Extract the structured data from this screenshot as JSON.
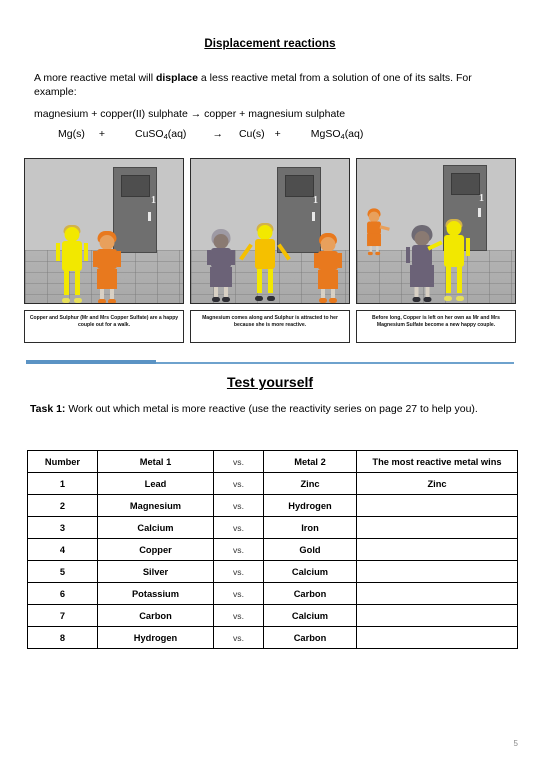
{
  "document": {
    "title": "Displacement reactions",
    "page_number": "5"
  },
  "intro": {
    "before_bold": "A more reactive metal will ",
    "bold": "displace",
    "after_bold": " a less reactive metal from a solution of one of its salts. For example:",
    "word_equation": "magnesium + copper(II) sulphate → copper + magnesium sulphate",
    "symbol_equation": {
      "reactant1": "Mg(s)",
      "plus1": "+",
      "reactant2_main": "CuSO",
      "reactant2_sub": "4",
      "reactant2_state": "(aq)",
      "arrow": "→",
      "product1": "Cu(s)",
      "plus2": "+",
      "product2_main": "MgSO",
      "product2_sub": "4",
      "product2_state": "(aq)"
    }
  },
  "storyboard": {
    "panels": [
      {
        "caption": "Copper and Sulphur (Mr and Mrs Copper Sulfate) are a happy couple out for a walk.",
        "door_number": "1"
      },
      {
        "caption": "Magnesium comes along and Sulphur is attracted to her because she is more reactive.",
        "door_number": "1"
      },
      {
        "caption": "Before long, Copper is left on her own as Mr and Mrs Magnesium Sulfate become a new happy couple.",
        "door_number": "1"
      }
    ]
  },
  "test_section": {
    "heading": "Test yourself",
    "task_label": "Task 1:",
    "task_text": " Work out which metal is more reactive (use the reactivity series on page 27 to help you)."
  },
  "table": {
    "headers": [
      "Number",
      "Metal 1",
      "vs.",
      "Metal 2",
      "The most reactive metal wins"
    ],
    "rows": [
      {
        "number": "1",
        "metal1": "Lead",
        "vs": "vs.",
        "metal2": "Zinc",
        "winner": "Zinc"
      },
      {
        "number": "2",
        "metal1": "Magnesium",
        "vs": "vs.",
        "metal2": "Hydrogen",
        "winner": ""
      },
      {
        "number": "3",
        "metal1": "Calcium",
        "vs": "vs.",
        "metal2": "Iron",
        "winner": ""
      },
      {
        "number": "4",
        "metal1": "Copper",
        "vs": "vs.",
        "metal2": "Gold",
        "winner": ""
      },
      {
        "number": "5",
        "metal1": "Silver",
        "vs": "vs.",
        "metal2": "Calcium",
        "winner": ""
      },
      {
        "number": "6",
        "metal1": "Potassium",
        "vs": "vs.",
        "metal2": "Carbon",
        "winner": ""
      },
      {
        "number": "7",
        "metal1": "Carbon",
        "vs": "vs.",
        "metal2": "Calcium",
        "winner": ""
      },
      {
        "number": "8",
        "metal1": "Hydrogen",
        "vs": "vs.",
        "metal2": "Carbon",
        "winner": ""
      }
    ]
  },
  "colors": {
    "divider_blue": "#5b93c4",
    "magnesium_yellow": "#f2e800",
    "copper_orange": "#e8791e",
    "sulphur_purple": "#6b6277"
  }
}
